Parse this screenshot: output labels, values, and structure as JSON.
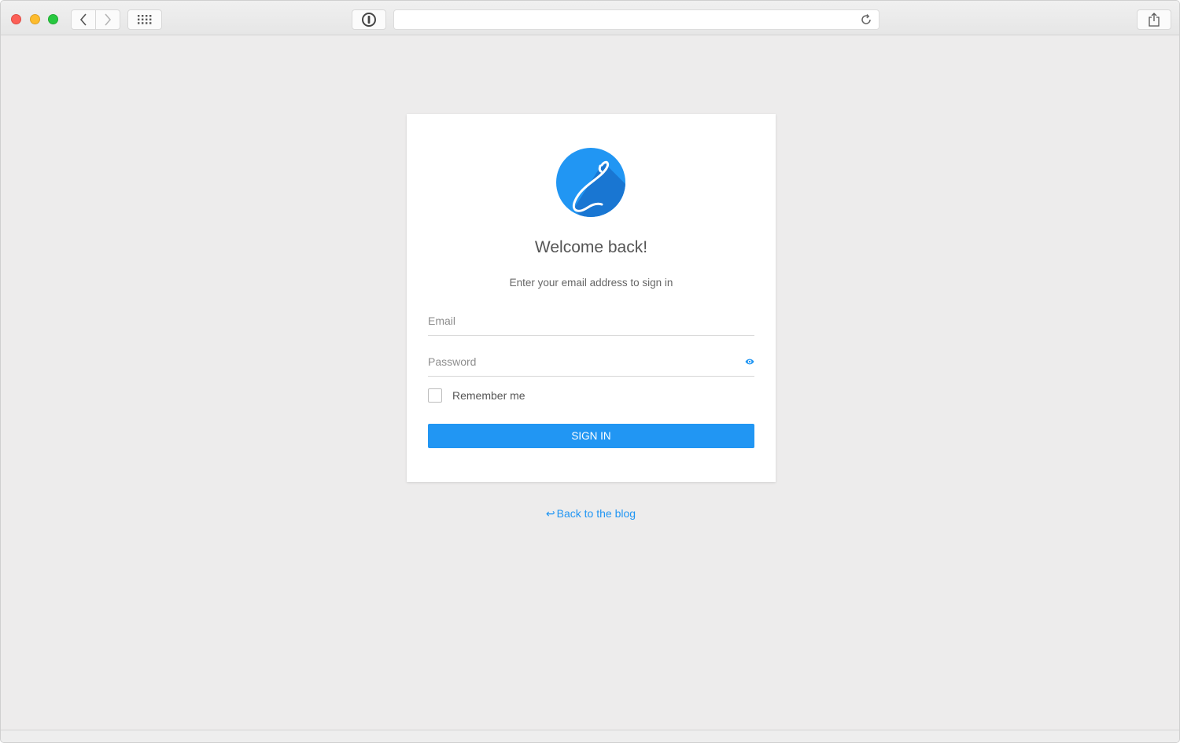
{
  "browser": {
    "url": "",
    "icons": {
      "back": "chevron-left-icon",
      "forward": "chevron-right-icon",
      "grid": "grid-icon",
      "password": "password-manager-icon",
      "reload": "reload-icon",
      "share": "share-icon"
    }
  },
  "login": {
    "title": "Welcome back!",
    "subtitle": "Enter your email address to sign in",
    "email_placeholder": "Email",
    "password_placeholder": "Password",
    "remember_label": "Remember me",
    "signin_label": "SIGN IN",
    "back_link": "Back to the blog",
    "back_arrow": "↩"
  },
  "colors": {
    "accent": "#2196f3",
    "logo_primary": "#2196f3",
    "logo_shadow": "#1976d2",
    "background": "#edecec"
  }
}
